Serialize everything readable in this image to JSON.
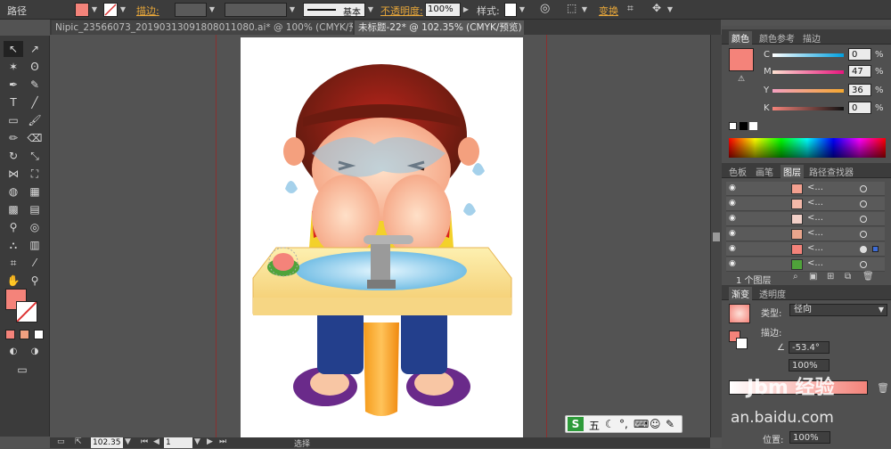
{
  "control_bar": {
    "path_label": "路径",
    "stroke_label": "描边:",
    "stroke_style": "基本",
    "opacity_label": "不透明度:",
    "opacity_value": "100%",
    "style_label": "样式:",
    "transform_label": "变换"
  },
  "tabs": [
    {
      "label": "Nipic_23566073_20190313091808011080.ai* @ 100% (CMYK/预览)",
      "close": "×"
    },
    {
      "label": "未标题-22* @ 102.35% (CMYK/预览)",
      "close": "×"
    }
  ],
  "color_panel": {
    "tabs": [
      "颜色",
      "颜色参考",
      "描边"
    ],
    "sliders": [
      {
        "label": "C",
        "value": "0",
        "unit": "%"
      },
      {
        "label": "M",
        "value": "47",
        "unit": "%"
      },
      {
        "label": "Y",
        "value": "36",
        "unit": "%"
      },
      {
        "label": "K",
        "value": "0",
        "unit": "%"
      }
    ],
    "swatch_color": "#f4837a"
  },
  "layers_panel": {
    "tabs": [
      "色板",
      "画笔",
      "图层",
      "路径查找器"
    ],
    "rows": [
      {
        "name": "<...",
        "thumb_color": "#f4a08f"
      },
      {
        "name": "<...",
        "thumb_color": "#f3b8a8"
      },
      {
        "name": "<...",
        "thumb_color": "#f2d0c8"
      },
      {
        "name": "<...",
        "thumb_color": "#e9a58c"
      },
      {
        "name": "<...",
        "thumb_color": "#f4837a"
      },
      {
        "name": "<...",
        "thumb_color": "#4fa33a"
      }
    ],
    "footer": "1 个图层"
  },
  "gradient_panel": {
    "tabs": [
      "渐变",
      "透明度"
    ],
    "type_label": "类型:",
    "type_value": "径向",
    "stroke_label": "描边:",
    "angle": "-53.4°",
    "ratio": "100%",
    "location_label": "位置:",
    "location_value": "100%"
  },
  "status_bar": {
    "zoom": "102.35",
    "page": "1",
    "mode": "选择"
  },
  "ime_bar": {
    "label": "五"
  },
  "watermark": {
    "text": "Jbm 经验",
    "url": "an.baidu.com"
  },
  "colors": {
    "accent": "#f4837a",
    "guide": "#8a2f2f"
  }
}
